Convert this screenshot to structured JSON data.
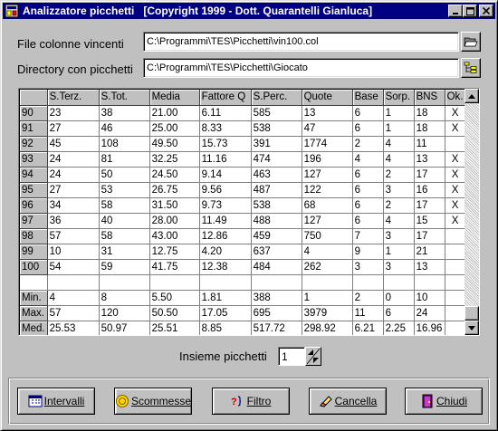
{
  "window": {
    "title": "Analizzatore picchetti   [Copyright 1999 - Dott. Quarantelli Gianluca]",
    "minimize": "_",
    "maximize": "□",
    "close": "×"
  },
  "files": {
    "col_label": "File colonne vincenti",
    "col_value": "C:\\Programmi\\TES\\Picchetti\\vin100.col",
    "dir_label": "Directory con picchetti",
    "dir_value": "C:\\Programmi\\TES\\Picchetti\\Giocato"
  },
  "grid": {
    "columns": [
      "S.Terz.",
      "S.Tot.",
      "Media",
      "Fattore Q",
      "S.Perc.",
      "Quote",
      "Base",
      "Sorp.",
      "BNS",
      "Ok."
    ],
    "rows": [
      {
        "id": "90",
        "cells": [
          "23",
          "38",
          "21.00",
          "6.11",
          "585",
          "13",
          "6",
          "1",
          "18",
          "X"
        ]
      },
      {
        "id": "91",
        "cells": [
          "27",
          "46",
          "25.00",
          "8.33",
          "538",
          "47",
          "6",
          "1",
          "18",
          "X"
        ]
      },
      {
        "id": "92",
        "cells": [
          "45",
          "108",
          "49.50",
          "15.73",
          "391",
          "1774",
          "2",
          "4",
          "11",
          ""
        ]
      },
      {
        "id": "93",
        "cells": [
          "24",
          "81",
          "32.25",
          "11.16",
          "474",
          "196",
          "4",
          "4",
          "13",
          "X"
        ]
      },
      {
        "id": "94",
        "cells": [
          "24",
          "50",
          "24.50",
          "9.14",
          "463",
          "127",
          "6",
          "2",
          "17",
          "X"
        ]
      },
      {
        "id": "95",
        "cells": [
          "27",
          "53",
          "26.75",
          "9.56",
          "487",
          "122",
          "6",
          "3",
          "16",
          "X"
        ]
      },
      {
        "id": "96",
        "cells": [
          "34",
          "58",
          "31.50",
          "9.73",
          "538",
          "68",
          "6",
          "2",
          "17",
          "X"
        ]
      },
      {
        "id": "97",
        "cells": [
          "36",
          "40",
          "28.00",
          "11.49",
          "488",
          "127",
          "6",
          "4",
          "15",
          "X"
        ]
      },
      {
        "id": "98",
        "cells": [
          "57",
          "58",
          "43.00",
          "12.86",
          "459",
          "750",
          "7",
          "3",
          "17",
          ""
        ]
      },
      {
        "id": "99",
        "cells": [
          "10",
          "31",
          "12.75",
          "4.20",
          "637",
          "4",
          "9",
          "1",
          "21",
          ""
        ]
      },
      {
        "id": "100",
        "cells": [
          "54",
          "59",
          "41.75",
          "12.38",
          "484",
          "262",
          "3",
          "3",
          "13",
          ""
        ]
      }
    ],
    "summary": [
      {
        "id": "Min.",
        "cells": [
          "4",
          "8",
          "5.50",
          "1.81",
          "388",
          "1",
          "2",
          "0",
          "10",
          ""
        ]
      },
      {
        "id": "Max.",
        "cells": [
          "57",
          "120",
          "50.50",
          "17.05",
          "695",
          "3979",
          "11",
          "6",
          "24",
          ""
        ]
      },
      {
        "id": "Med.",
        "cells": [
          "25.53",
          "50.97",
          "25.51",
          "8.85",
          "517.72",
          "298.92",
          "6.21",
          "2.25",
          "16.96",
          ""
        ]
      }
    ]
  },
  "spinner": {
    "label": "Insieme picchetti",
    "value": "1"
  },
  "buttons": {
    "intervalli": "Intervalli",
    "scommesse": "Scommesse",
    "filtro": "Filtro",
    "cancella": "Cancella",
    "chiudi": "Chiudi"
  }
}
